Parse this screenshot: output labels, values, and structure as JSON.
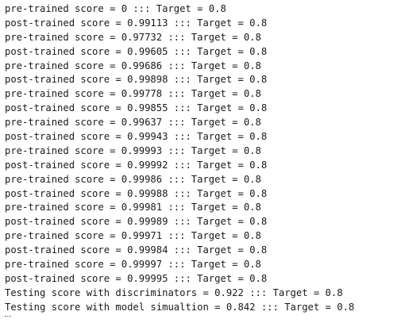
{
  "console": {
    "lines": [
      "pre-trained score = 0 ::: Target = 0.8",
      "post-trained score = 0.99113 ::: Target = 0.8",
      "pre-trained score = 0.97732 ::: Target = 0.8",
      "post-trained score = 0.99605 ::: Target = 0.8",
      "pre-trained score = 0.99686 ::: Target = 0.8",
      "post-trained score = 0.99898 ::: Target = 0.8",
      "pre-trained score = 0.99778 ::: Target = 0.8",
      "post-trained score = 0.99855 ::: Target = 0.8",
      "pre-trained score = 0.99637 ::: Target = 0.8",
      "post-trained score = 0.99943 ::: Target = 0.8",
      "pre-trained score = 0.99993 ::: Target = 0.8",
      "post-trained score = 0.99992 ::: Target = 0.8",
      "pre-trained score = 0.99986 ::: Target = 0.8",
      "post-trained score = 0.99988 ::: Target = 0.8",
      "pre-trained score = 0.99981 ::: Target = 0.8",
      "post-trained score = 0.99989 ::: Target = 0.8",
      "pre-trained score = 0.99971 ::: Target = 0.8",
      "post-trained score = 0.99984 ::: Target = 0.8",
      "pre-trained score = 0.99997 ::: Target = 0.8",
      "post-trained score = 0.99995 ::: Target = 0.8",
      "Testing score with discriminators = 0.922 ::: Target = 0.8",
      "Testing score with model simualtion = 0.842 ::: Target = 0.8"
    ]
  }
}
